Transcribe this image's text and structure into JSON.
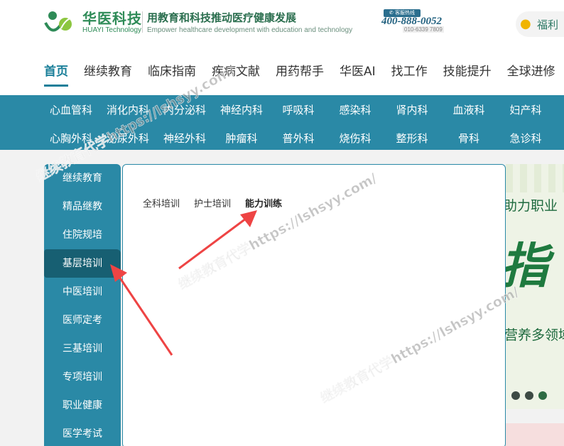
{
  "header": {
    "brand_name": "华医科技",
    "brand_en": "HUAYI Technology",
    "slogan": "用教育和科技推动医疗健康发展",
    "slogan_en": "Empower healthcare development with education and technology",
    "hotline_label": "客服热线",
    "hotline_number": "400-888-0052",
    "hotline_sub": "010-6339 7809",
    "welfare_label": "福利",
    "welfare_icon": "coins-icon"
  },
  "main_nav": [
    "首页",
    "继续教育",
    "临床指南",
    "疾病文献",
    "用药帮手",
    "华医AI",
    "找工作",
    "技能提升",
    "全球进修"
  ],
  "departments": {
    "row1": [
      "心血管科",
      "消化内科",
      "内分泌科",
      "神经内科",
      "呼吸科",
      "感染科",
      "肾内科",
      "血液科",
      "妇产科"
    ],
    "row2": [
      "心胸外科",
      "泌尿外科",
      "神经外科",
      "肿瘤科",
      "普外科",
      "烧伤科",
      "整形科",
      "骨科",
      "急诊科"
    ]
  },
  "sidebar": {
    "items": [
      "继续教育",
      "精品继教",
      "住院规培",
      "基层培训",
      "中医培训",
      "医师定考",
      "三基培训",
      "专项培训",
      "职业健康",
      "医学考试"
    ],
    "active_index": 3
  },
  "tabs": [
    "全科培训",
    "护士培训",
    "能力训练"
  ],
  "active_tab": 2,
  "banner": {
    "text1": "助力职业",
    "big": "指",
    "text2": "营养多领域"
  },
  "watermark": "继续教育代学https://lshsyy.com/",
  "colors": {
    "brand_green": "#2e8b57",
    "nav_teal": "#2a89a6",
    "active_dark": "#175f72",
    "arrow_red": "#ee4444"
  }
}
